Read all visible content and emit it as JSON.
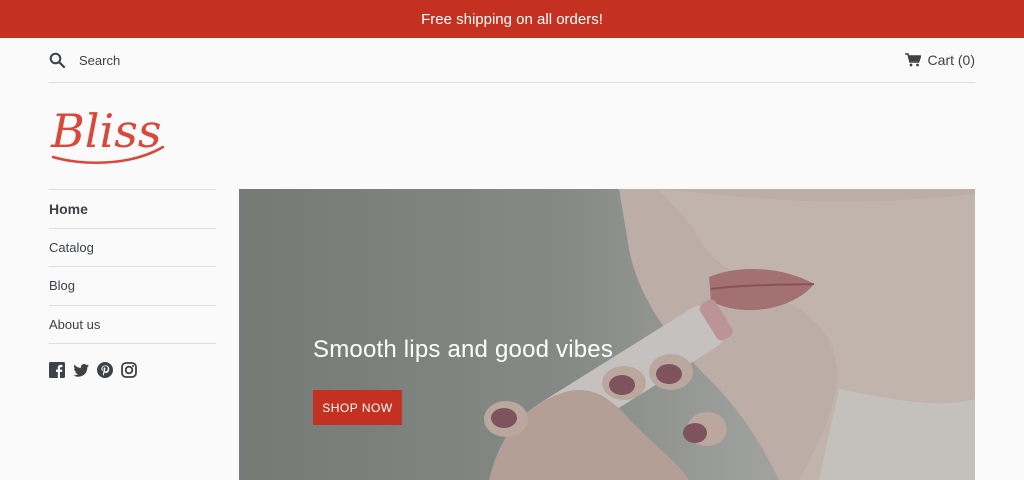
{
  "announcement": {
    "text": "Free shipping on all orders!"
  },
  "header": {
    "search_label": "Search",
    "cart_label": "Cart (0)"
  },
  "brand": {
    "logo_text": "Bliss"
  },
  "sidebar": {
    "items": [
      {
        "label": "Home",
        "active": true
      },
      {
        "label": "Catalog"
      },
      {
        "label": "Blog"
      },
      {
        "label": "About us"
      }
    ],
    "social": [
      "facebook-icon",
      "twitter-icon",
      "pinterest-icon",
      "instagram-icon"
    ]
  },
  "hero": {
    "title": "Smooth lips and good vibes",
    "button_label": "SHOP NOW"
  },
  "colors": {
    "accent": "#c43121",
    "text": "#3d4246",
    "background": "#fafafa"
  }
}
